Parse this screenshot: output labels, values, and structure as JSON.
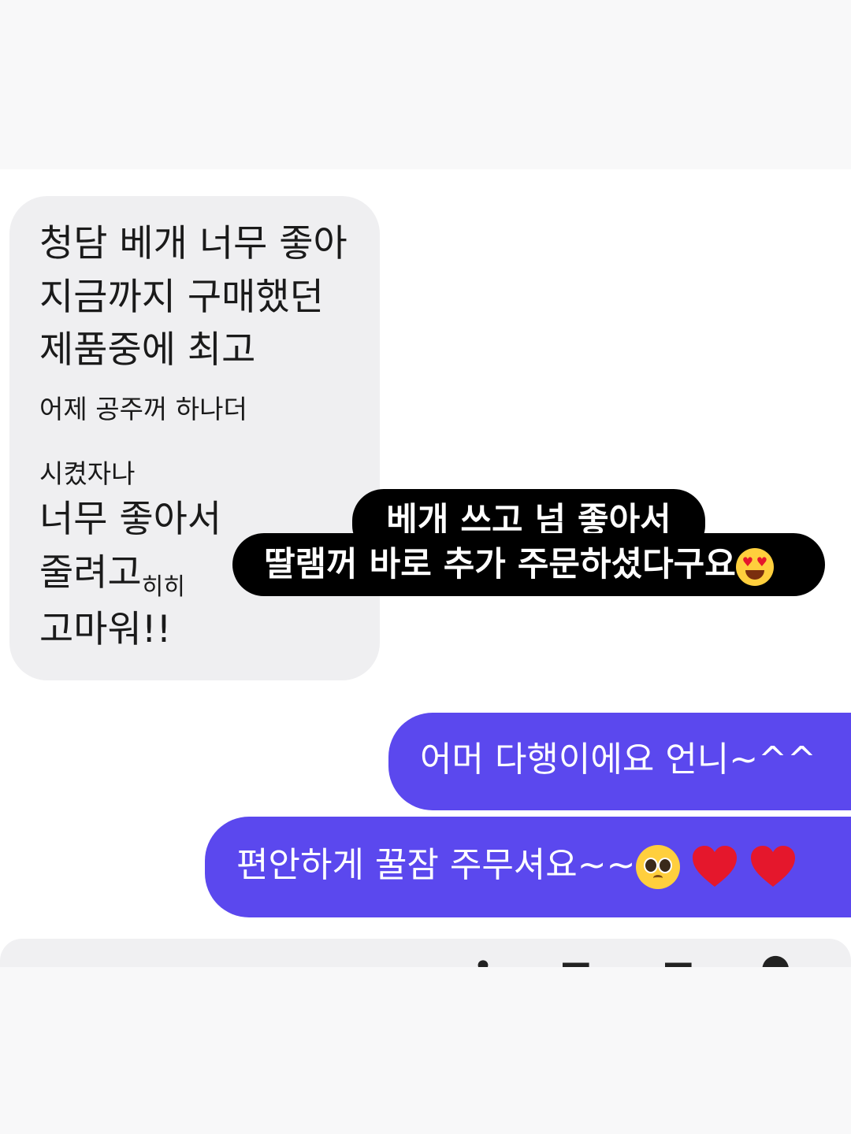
{
  "received": {
    "lines": [
      "청담 베개 너무 좋아",
      "지금까지 구매했던",
      "제품중에 최고"
    ],
    "small_line_1": "어제 공주꺼 하나더",
    "small_line_2": "시켰자나",
    "line_4": "너무 좋아서",
    "line_5_main": "줄려고",
    "line_5_small": "히히",
    "line_6": "고마워!!"
  },
  "caption": {
    "line_1": "베개 쓰고 넘 좋아서",
    "line_2": "딸램꺼 바로 추가 주문하셨다구요"
  },
  "sent": {
    "message_1": "어머 다행이에요 언니~^^",
    "message_2": "편안하게 꿀잠 주무셔요~~"
  },
  "icons": [
    "heart-eyes-emoji",
    "pleading-face-emoji",
    "red-heart-emoji"
  ],
  "colors": {
    "received_bubble": "#efeff1",
    "sent_bubble": "#5b48ee",
    "caption_bg": "#000000",
    "heart": "#e5172c"
  }
}
